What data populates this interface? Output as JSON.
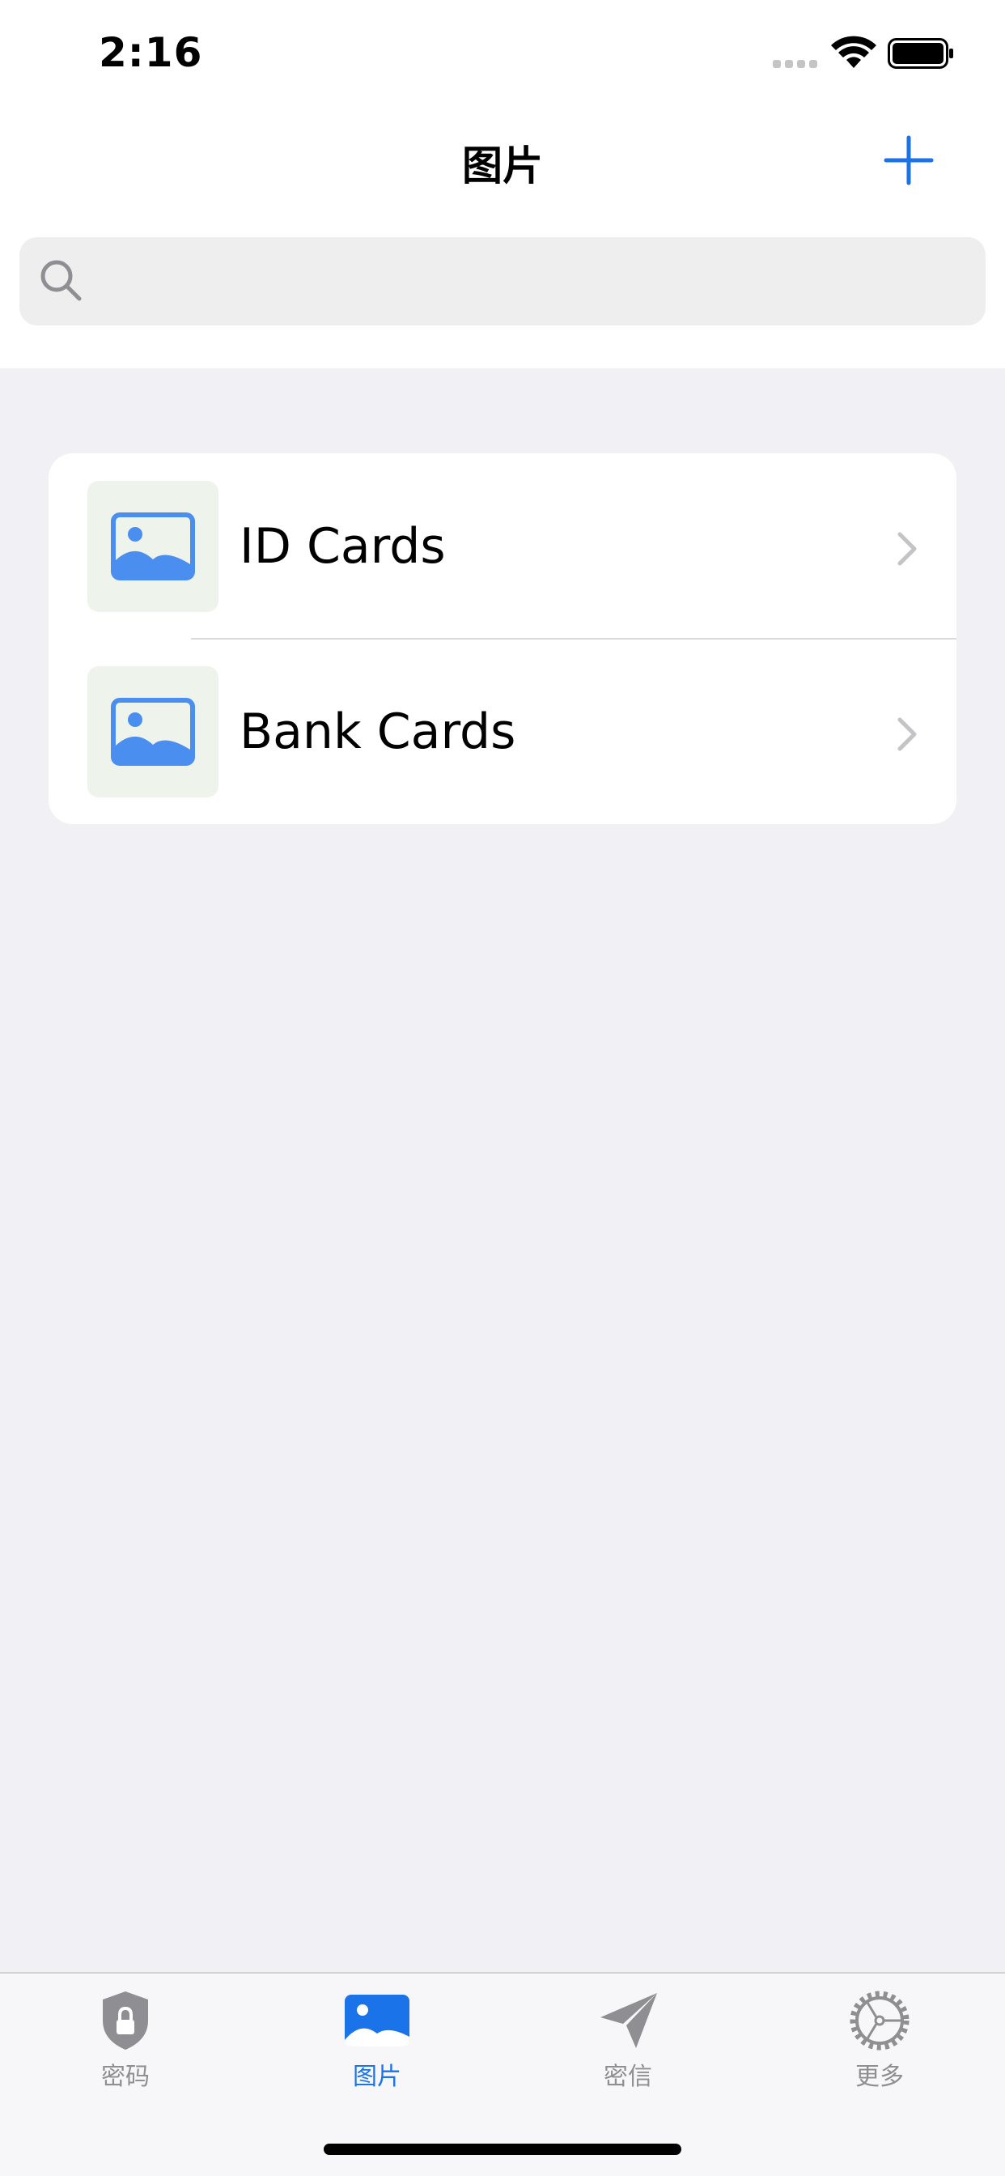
{
  "status_bar": {
    "time": "2:16"
  },
  "nav": {
    "title": "图片"
  },
  "search": {
    "placeholder": "",
    "value": ""
  },
  "list": {
    "items": [
      {
        "label": "ID Cards",
        "icon": "photo-icon"
      },
      {
        "label": "Bank Cards",
        "icon": "photo-icon"
      }
    ]
  },
  "tab_bar": {
    "tabs": [
      {
        "label": "密码",
        "icon": "shield-lock-icon",
        "active": false
      },
      {
        "label": "图片",
        "icon": "photo-icon",
        "active": true
      },
      {
        "label": "密信",
        "icon": "paper-plane-icon",
        "active": false
      },
      {
        "label": "更多",
        "icon": "gear-icon",
        "active": false
      }
    ]
  },
  "colors": {
    "accent": "#1a73e8",
    "photo_icon": "#4a8ff0",
    "tab_inactive": "#8e8e93",
    "background": "#f0f0f5"
  }
}
